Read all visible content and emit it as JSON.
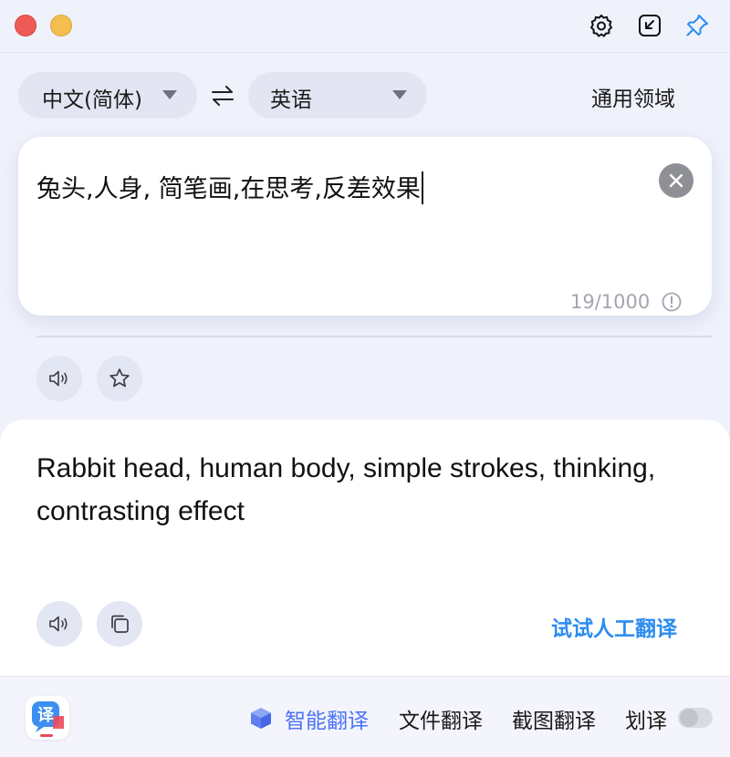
{
  "source_lang": "中文(简体)",
  "target_lang": "英语",
  "domain": "通用领域",
  "input": {
    "text": "兔头,人身, 简笔画,在思考,反差效果",
    "count": "19/1000"
  },
  "output": {
    "text": "Rabbit head, human body, simple strokes, thinking, contrasting effect"
  },
  "human_translate": "试试人工翻译",
  "bottom": {
    "smart": "智能翻译",
    "file": "文件翻译",
    "screenshot": "截图翻译",
    "selection": "划译",
    "logo_text": "译"
  },
  "colors": {
    "accent": "#2b8cf0",
    "active": "#4a72f5",
    "close": "#ee5b57",
    "minimize": "#f4bf4f"
  },
  "icons": [
    "settings-icon",
    "shrink-window-icon",
    "pin-icon",
    "swap-icon",
    "clear-icon",
    "info-icon",
    "speaker-icon",
    "star-icon",
    "copy-icon",
    "cube-icon",
    "app-logo-icon"
  ]
}
